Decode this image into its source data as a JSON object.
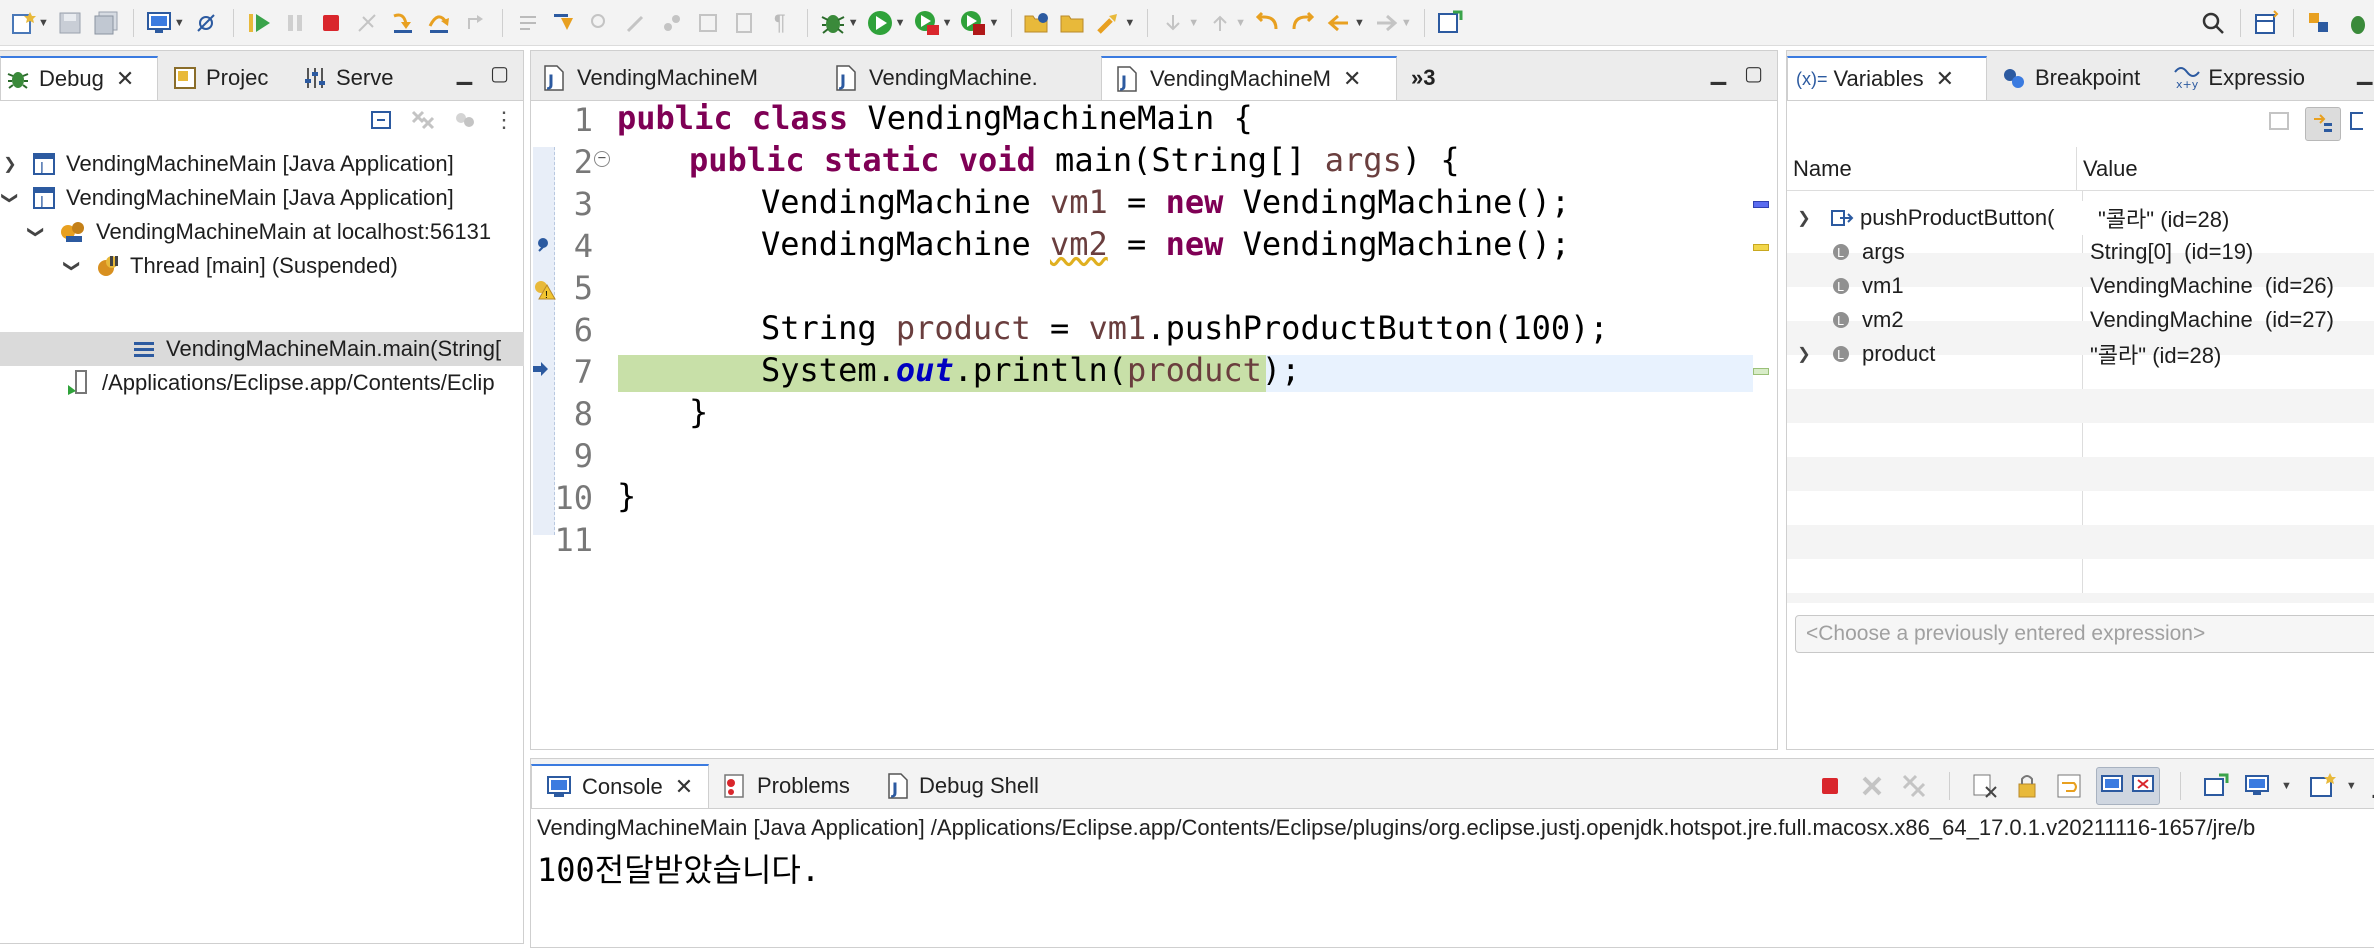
{
  "colors": {
    "accent": "#3b7be0",
    "keyword": "#7f0055",
    "local_var": "#6a3e3e",
    "field": "#0000c0",
    "current_line": "#c8e0a8",
    "line_highlight": "#e8f2fe"
  },
  "toolbar": {
    "icons": [
      "new-icon",
      "save-icon",
      "save-all-icon",
      "open-console-icon",
      "skip-breakpoints-icon",
      "resume-icon",
      "suspend-icon",
      "terminate-icon",
      "disconnect-icon",
      "step-into-icon",
      "step-over-icon",
      "step-return-icon",
      "drop-to-frame-icon",
      "use-step-filters-icon",
      "debug-icon",
      "run-icon",
      "coverage-icon",
      "external-tools-icon",
      "open-type-icon",
      "open-task-icon",
      "search-icon",
      "perspective-icon",
      "java-perspective-icon",
      "debug-perspective-icon"
    ]
  },
  "debug_panel": {
    "tabs": [
      {
        "label": "Debug"
      },
      {
        "label": "Projec"
      },
      {
        "label": "Serve"
      }
    ],
    "tree": [
      {
        "label": "VendingMachineMain [Java Application]"
      },
      {
        "label": "VendingMachineMain [Java Application]"
      },
      {
        "label": "VendingMachineMain at localhost:56131"
      },
      {
        "label": "Thread [main] (Suspended)"
      },
      {
        "label": "VendingMachineMain.main(String["
      },
      {
        "label": "/Applications/Eclipse.app/Contents/Eclip"
      }
    ]
  },
  "editor": {
    "tabs": [
      {
        "label": "VendingMachineM"
      },
      {
        "label": "VendingMachine."
      },
      {
        "label": "VendingMachineM"
      }
    ],
    "overflow": "»3",
    "line_numbers": [
      "1",
      "2",
      "3",
      "4",
      "5",
      "6",
      "7",
      "8",
      "9",
      "10",
      "11"
    ],
    "code": {
      "l1": {
        "kw1": "public",
        "kw2": "class",
        "rest": " VendingMachineMain {"
      },
      "l2": {
        "kw1": "public",
        "kw2": "static",
        "kw3": "void",
        "mid": " main(String[] ",
        "arg": "args",
        "end": ") {"
      },
      "l3": {
        "type": "VendingMachine ",
        "var": "vm1",
        "eq": " = ",
        "kw": "new",
        "rest": " VendingMachine();"
      },
      "l4": {
        "type": "VendingMachine ",
        "var": "vm2",
        "eq": " = ",
        "kw": "new",
        "rest": " VendingMachine();"
      },
      "l6": {
        "type": "String ",
        "var": "product",
        "eq": " = ",
        "obj": "vm1",
        "rest": ".pushProductButton(100);"
      },
      "l7": {
        "pre": "System.",
        "fld": "out",
        "mid": ".println(",
        "var": "product",
        "end": ");"
      },
      "l8": "}",
      "l10": "}"
    }
  },
  "variables_panel": {
    "tabs": [
      {
        "label": "Variables"
      },
      {
        "label": "Breakpoint"
      },
      {
        "label": "Expressio"
      }
    ],
    "columns": {
      "name": "Name",
      "value": "Value"
    },
    "rows": [
      {
        "name": "pushProductButton(",
        "value": "\"콜라\" (id=28)"
      },
      {
        "name": "args",
        "value": "String[0]  (id=19)"
      },
      {
        "name": "vm1",
        "value": "VendingMachine  (id=26)"
      },
      {
        "name": "vm2",
        "value": "VendingMachine  (id=27)"
      },
      {
        "name": "product",
        "value": "\"콜라\" (id=28)"
      }
    ],
    "expression_placeholder": "<Choose a previously entered expression>"
  },
  "console_panel": {
    "tabs": [
      {
        "label": "Console"
      },
      {
        "label": "Problems"
      },
      {
        "label": "Debug Shell"
      }
    ],
    "header": "VendingMachineMain [Java Application] /Applications/Eclipse.app/Contents/Eclipse/plugins/org.eclipse.justj.openjdk.hotspot.jre.full.macosx.x86_64_17.0.1.v20211116-1657/jre/b",
    "output": "100전달받았습니다."
  }
}
